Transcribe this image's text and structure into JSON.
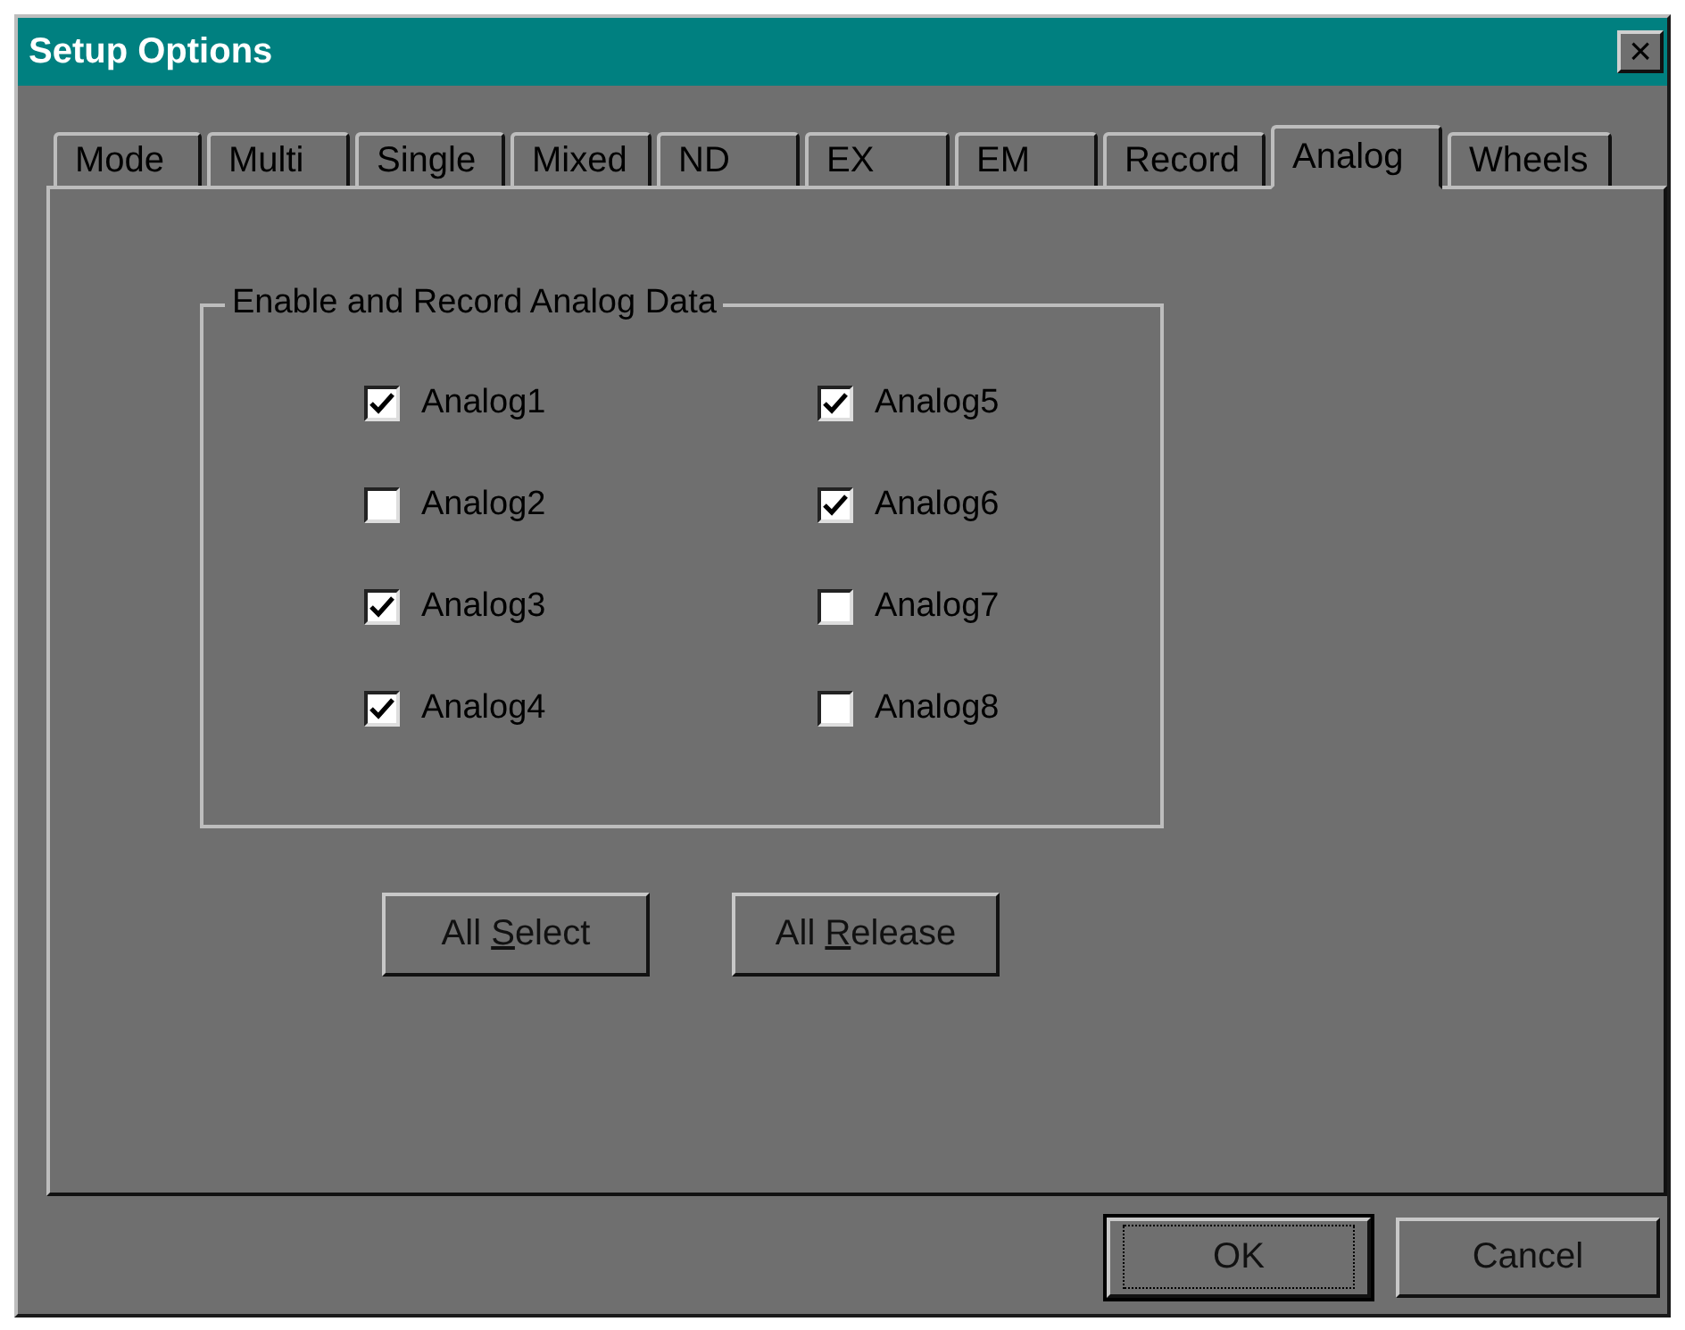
{
  "window": {
    "title": "Setup Options",
    "close": "×"
  },
  "tabs": [
    {
      "label": "Mode",
      "selected": false
    },
    {
      "label": "Multi",
      "selected": false
    },
    {
      "label": "Single",
      "selected": false
    },
    {
      "label": "Mixed",
      "selected": false
    },
    {
      "label": "ND",
      "selected": false
    },
    {
      "label": "EX",
      "selected": false
    },
    {
      "label": "EM",
      "selected": false
    },
    {
      "label": "Record",
      "selected": false
    },
    {
      "label": "Analog",
      "selected": true
    },
    {
      "label": "Wheels",
      "selected": false
    }
  ],
  "group": {
    "title": "Enable and Record Analog Data",
    "checkboxes": [
      {
        "label": "Analog1",
        "checked": true
      },
      {
        "label": "Analog2",
        "checked": false
      },
      {
        "label": "Analog3",
        "checked": true
      },
      {
        "label": "Analog4",
        "checked": true
      },
      {
        "label": "Analog5",
        "checked": true
      },
      {
        "label": "Analog6",
        "checked": true
      },
      {
        "label": "Analog7",
        "checked": false
      },
      {
        "label": "Analog8",
        "checked": false
      }
    ]
  },
  "panel_buttons": [
    {
      "before": "All ",
      "mnemonic": "S",
      "after": "elect"
    },
    {
      "before": "All ",
      "mnemonic": "R",
      "after": "elease"
    }
  ],
  "dialog_buttons": [
    {
      "label": "OK",
      "default": true
    },
    {
      "label": "Cancel",
      "default": false
    }
  ]
}
